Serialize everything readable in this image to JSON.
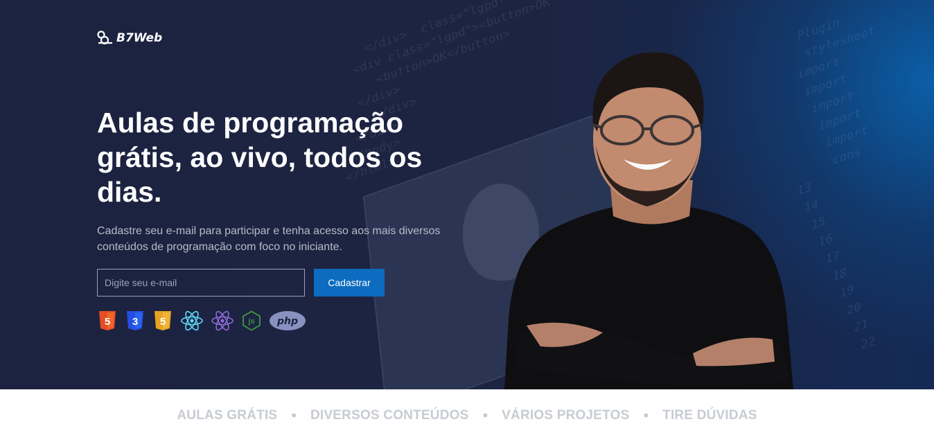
{
  "brand": {
    "name": "B7Web"
  },
  "hero": {
    "headline": "Aulas de programação grátis, ao vivo, todos os dias.",
    "subtext": "Cadastre seu e-mail para participar e tenha acesso aos mais diversos conteúdos de programação com foco no iniciante.",
    "email_placeholder": "Digite seu e-mail",
    "submit_label": "Cadastrar"
  },
  "technologies": [
    {
      "name": "HTML5",
      "icon": "html5-icon",
      "label": "5",
      "color": "#e44d26"
    },
    {
      "name": "CSS3",
      "icon": "css3-icon",
      "label": "3",
      "color": "#264de4"
    },
    {
      "name": "JavaScript",
      "icon": "js-shield-icon",
      "label": "5",
      "color": "#f0a92a"
    },
    {
      "name": "React",
      "icon": "react-icon",
      "color": "#61dafb"
    },
    {
      "name": "Redux/React Native",
      "icon": "react-purple-icon",
      "color": "#8e6ad8"
    },
    {
      "name": "Node.js",
      "icon": "nodejs-icon",
      "label": "js",
      "color": "#3e8e41"
    },
    {
      "name": "PHP",
      "icon": "php-icon",
      "label": "php",
      "color": "#8892bf"
    }
  ],
  "features": {
    "items": [
      "AULAS GRÁTIS",
      "DIVERSOS CONTEÚDOS",
      "VÁRIOS PROJETOS",
      "TIRE DÚVIDAS"
    ],
    "separator": "•"
  },
  "colors": {
    "hero_bg": "#1c2340",
    "accent_blue": "#0d6cbf",
    "feature_text": "#c7cbd2"
  }
}
